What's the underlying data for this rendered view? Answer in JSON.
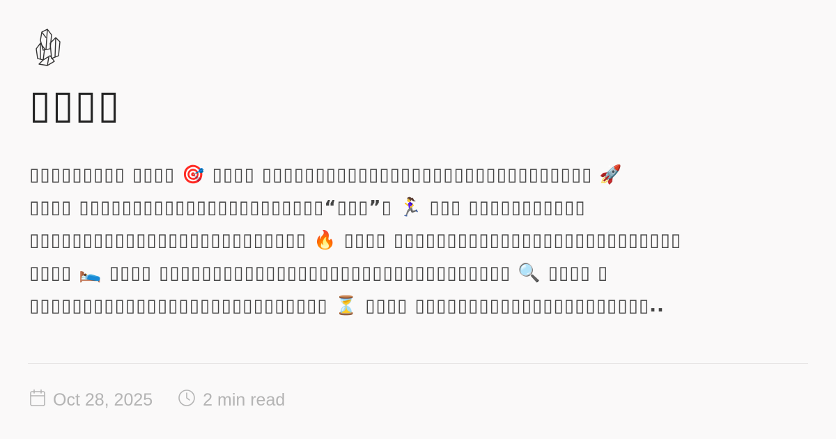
{
  "site": {
    "logo_icon": "crystal-cluster-icon"
  },
  "post": {
    "title": "▯▯▯▯",
    "excerpt_lines": [
      "▯▯▯▯▯▯▯▯▯ ▯▯▯▯ 🎯 ▯▯▯▯ ▯▯▯▯▯▯▯▯▯▯▯▯▯▯▯▯▯▯▯▯▯▯▯▯▯▯▯▯▯▯▯ 🚀",
      "▯▯▯▯ ▯▯▯▯▯▯▯▯▯▯▯▯▯▯▯▯▯▯▯▯▯▯▯“▯▯▯”▯ 🏃‍♀️ ▯▯▯ ▯▯▯▯▯▯▯▯▯▯▯",
      "▯▯▯▯▯▯▯▯▯▯▯▯▯▯▯▯▯▯▯▯▯▯▯▯▯▯ 🔥 ▯▯▯▯ ▯▯▯▯▯▯▯▯▯▯▯▯▯▯▯▯▯▯▯▯▯▯▯▯▯▯▯",
      "▯▯▯▯ 🛌 ▯▯▯▯ ▯▯▯▯▯▯▯▯▯▯▯▯▯▯▯▯▯▯▯▯▯▯▯▯▯▯▯▯▯▯▯▯▯ 🔍 ▯▯▯▯ ▯",
      "▯▯▯▯▯▯▯▯▯▯▯▯▯▯▯▯▯▯▯▯▯▯▯▯▯▯▯▯ ⏳ ▯▯▯▯ ▯▯▯▯▯▯▯▯▯▯▯▯▯▯▯▯▯▯▯▯▯▯.."
    ],
    "date": "Oct 28, 2025",
    "date_icon": "calendar-icon",
    "read_time": "2 min read",
    "read_time_icon": "clock-icon"
  }
}
